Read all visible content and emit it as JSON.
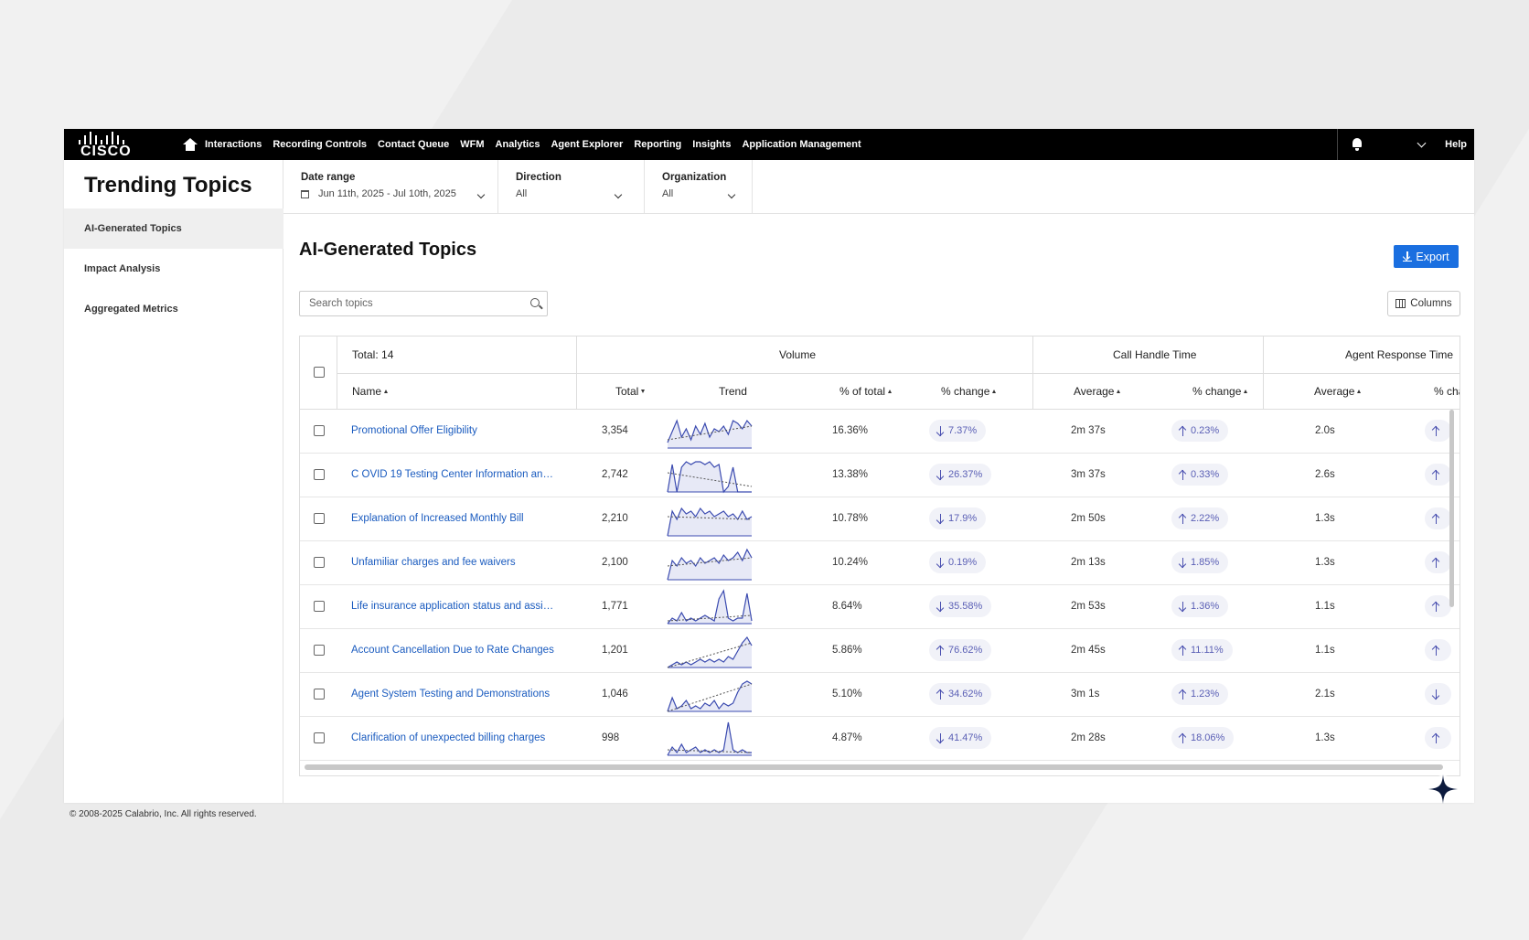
{
  "nav": {
    "logo": "CISCO",
    "links": [
      "Interactions",
      "Recording Controls",
      "Contact Queue",
      "WFM",
      "Analytics",
      "Agent Explorer",
      "Reporting",
      "Insights",
      "Application Management"
    ],
    "help": "Help"
  },
  "page_title": "Trending Topics",
  "sidebar": {
    "items": [
      {
        "label": "AI-Generated Topics",
        "active": true
      },
      {
        "label": "Impact Analysis",
        "active": false
      },
      {
        "label": "Aggregated Metrics",
        "active": false
      }
    ]
  },
  "filters": {
    "date_range": {
      "label": "Date range",
      "value": "Jun 11th, 2025 - Jul 10th, 2025"
    },
    "direction": {
      "label": "Direction",
      "value": "All"
    },
    "organization": {
      "label": "Organization",
      "value": "All"
    }
  },
  "main": {
    "title": "AI-Generated Topics",
    "export_label": "Export",
    "search_placeholder": "Search topics",
    "columns_label": "Columns"
  },
  "table": {
    "total_label": "Total: 14",
    "groups": {
      "volume": "Volume",
      "call_handle_time": "Call Handle Time",
      "agent_response_time": "Agent Response Time"
    },
    "columns": {
      "name": "Name",
      "total": "Total",
      "trend": "Trend",
      "pct_total": "% of total",
      "pct_change": "% change",
      "cht_avg": "Average",
      "cht_change": "% change",
      "art_avg": "Average",
      "art_change": "% cha"
    },
    "rows": [
      {
        "name": "Promotional Offer Eligibility",
        "total": "3,354",
        "pct_total": "16.36%",
        "vol_dir": "down",
        "vol_change": "7.37%",
        "cht_avg": "2m 37s",
        "cht_dir": "up",
        "cht_change": "0.23%",
        "art_avg": "2.0s",
        "art_dir": "up",
        "trend": [
          10,
          6,
          2,
          8,
          5,
          9,
          4,
          7,
          3,
          8,
          5,
          6,
          4,
          7,
          2,
          3,
          5,
          2,
          4
        ],
        "trend_line": [
          9,
          4
        ]
      },
      {
        "name": "C OVID 19 Testing Center Information and ...",
        "total": "2,742",
        "pct_total": "13.38%",
        "vol_dir": "down",
        "vol_change": "26.37%",
        "cht_avg": "3m 37s",
        "cht_dir": "up",
        "cht_change": "0.33%",
        "art_avg": "2.6s",
        "art_dir": "up",
        "trend": [
          12,
          2,
          12,
          3,
          1,
          2,
          1,
          1,
          2,
          1,
          3,
          2,
          12,
          10,
          3,
          12,
          12,
          12,
          12
        ],
        "trend_line": [
          5,
          10
        ]
      },
      {
        "name": "Explanation of Increased Monthly Bill",
        "total": "2,210",
        "pct_total": "10.78%",
        "vol_dir": "down",
        "vol_change": "17.9%",
        "cht_avg": "2m 50s",
        "cht_dir": "up",
        "cht_change": "2.22%",
        "art_avg": "1.3s",
        "art_dir": "up",
        "trend": [
          12,
          3,
          6,
          2,
          4,
          3,
          5,
          2,
          4,
          3,
          5,
          4,
          3,
          5,
          4,
          6,
          3,
          6,
          5
        ],
        "trend_line": [
          5,
          6
        ]
      },
      {
        "name": "Unfamiliar charges and fee waivers",
        "total": "2,100",
        "pct_total": "10.24%",
        "vol_dir": "down",
        "vol_change": "0.19%",
        "cht_avg": "2m 13s",
        "cht_dir": "down",
        "cht_change": "1.85%",
        "art_avg": "1.3s",
        "art_dir": "up",
        "trend": [
          12,
          5,
          7,
          4,
          6,
          5,
          7,
          4,
          6,
          5,
          4,
          6,
          3,
          5,
          4,
          2,
          5,
          1,
          4
        ],
        "trend_line": [
          7,
          4
        ]
      },
      {
        "name": "Life insurance application status and assist...",
        "total": "1,771",
        "pct_total": "8.64%",
        "vol_dir": "down",
        "vol_change": "35.58%",
        "cht_avg": "2m 53s",
        "cht_dir": "down",
        "cht_change": "1.36%",
        "art_avg": "1.1s",
        "art_dir": "up",
        "trend": [
          12,
          10,
          11,
          8,
          11,
          10,
          11,
          10,
          9,
          10,
          11,
          3,
          0,
          10,
          11,
          10,
          10,
          1,
          11
        ],
        "trend_line": [
          11,
          9
        ]
      },
      {
        "name": "Account Cancellation Due to Rate Changes",
        "total": "1,201",
        "pct_total": "5.86%",
        "vol_dir": "up",
        "vol_change": "76.62%",
        "cht_avg": "2m 45s",
        "cht_dir": "up",
        "cht_change": "11.11%",
        "art_avg": "1.1s",
        "art_dir": "up",
        "trend": [
          12,
          11,
          10,
          11,
          10,
          11,
          10,
          9,
          10,
          9,
          10,
          9,
          10,
          8,
          9,
          6,
          3,
          1,
          4
        ],
        "trend_line": [
          12,
          3
        ]
      },
      {
        "name": "Agent System Testing and Demonstrations",
        "total": "1,046",
        "pct_total": "5.10%",
        "vol_dir": "up",
        "vol_change": "34.62%",
        "cht_avg": "3m 1s",
        "cht_dir": "up",
        "cht_change": "1.23%",
        "art_avg": "2.1s",
        "art_dir": "down",
        "trend": [
          12,
          7,
          11,
          10,
          8,
          11,
          10,
          11,
          9,
          10,
          8,
          11,
          9,
          10,
          9,
          5,
          2,
          1,
          2
        ],
        "trend_line": [
          12,
          2
        ]
      },
      {
        "name": "Clarification of unexpected billing charges",
        "total": "998",
        "pct_total": "4.87%",
        "vol_dir": "down",
        "vol_change": "41.47%",
        "cht_avg": "2m 28s",
        "cht_dir": "up",
        "cht_change": "18.06%",
        "art_avg": "1.3s",
        "art_dir": "up",
        "trend": [
          12,
          9,
          11,
          8,
          11,
          10,
          9,
          11,
          10,
          11,
          10,
          11,
          10,
          0,
          10,
          11,
          10,
          11,
          11
        ],
        "trend_line": [
          10,
          11
        ]
      }
    ]
  },
  "footer": "© 2008-2025 Calabrio, Inc. All rights reserved.",
  "colors": {
    "accent": "#1a6fe0",
    "link": "#1a5bbf",
    "chip_text": "#5a5fb5",
    "spark": "#3b4bb0"
  }
}
